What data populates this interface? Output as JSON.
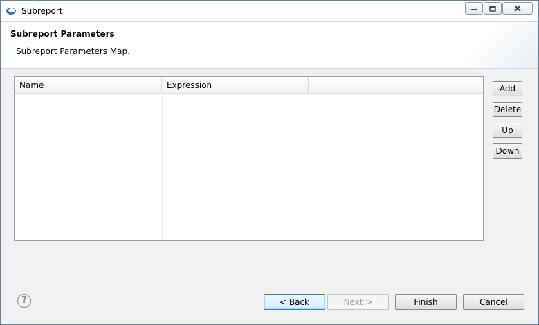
{
  "window": {
    "title": "Subreport"
  },
  "header": {
    "title": "Subreport Parameters",
    "description": "Subreport Parameters Map."
  },
  "table": {
    "columns": [
      "Name",
      "Expression",
      ""
    ],
    "rows": []
  },
  "side_buttons": {
    "add": "Add",
    "delete": "Delete",
    "up": "Up",
    "down": "Down"
  },
  "footer": {
    "back": "< Back",
    "next": "Next >",
    "finish": "Finish",
    "cancel": "Cancel",
    "help_icon": "?"
  },
  "icons": {
    "app": "eclipse-icon",
    "minimize": "minimize-icon",
    "maximize": "maximize-icon",
    "close": "close-icon",
    "help": "help-icon"
  }
}
